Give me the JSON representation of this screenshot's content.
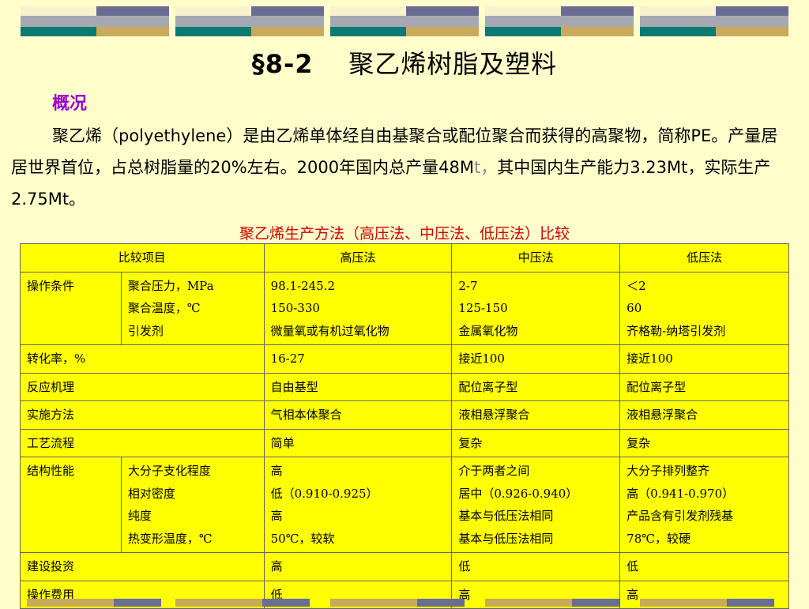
{
  "title_section": "§",
  "title_number": "8-2",
  "title_text": "聚乙烯树脂及塑料",
  "subhead": "概况",
  "paragraph": {
    "part1": "聚乙烯（polyethylene）是由乙烯单体经自由基聚合或配位聚合而获得的高聚物，简称PE。产量居居世界首位，占总树脂量的20%左右。2000年国内总产量48M",
    "dim": "t，",
    "part2": "其中国内生产能力3.23Mt，实际生产2.75Mt。"
  },
  "caption": "聚乙烯生产方法（高压法、中压法、低压法）比较",
  "table": {
    "header": {
      "item": "比较项目",
      "high": "高压法",
      "mid": "中压法",
      "low": "低压法"
    },
    "r1": {
      "label": "操作条件",
      "sub": [
        "聚合压力，MPa",
        "聚合温度，℃",
        "引发剂"
      ],
      "high": [
        "98.1-245.2",
        "150-330",
        "微量氧或有机过氧化物"
      ],
      "mid": [
        "2-7",
        "125-150",
        "金属氧化物"
      ],
      "low": [
        "＜2",
        "60",
        "齐格勒-纳塔引发剂"
      ]
    },
    "r2": {
      "label": "转化率，%",
      "high": "16-27",
      "mid": "接近100",
      "low": "接近100"
    },
    "r3": {
      "label": "反应机理",
      "high": "自由基型",
      "mid": "配位离子型",
      "low": "配位离子型"
    },
    "r4": {
      "label": "实施方法",
      "high": "气相本体聚合",
      "mid": "液相悬浮聚合",
      "low": "液相悬浮聚合"
    },
    "r5": {
      "label": "工艺流程",
      "high": "简单",
      "mid": "复杂",
      "low": "复杂"
    },
    "r6": {
      "label": "结构性能",
      "sub": [
        "大分子支化程度",
        "相对密度",
        "纯度",
        "热变形温度，℃"
      ],
      "high": [
        "高",
        "低（0.910-0.925）",
        "高",
        "50℃，较软"
      ],
      "mid": [
        "介于两者之间",
        "居中（0.926-0.940）",
        "基本与低压法相同",
        "基本与低压法相同"
      ],
      "low": [
        "大分子排列整齐",
        "高（0.941-0.970）",
        "产品含有引发剂残基",
        "78℃，较硬"
      ]
    },
    "r7": {
      "label": "建设投资",
      "high": "高",
      "mid": "低",
      "low": "低"
    },
    "r8": {
      "label": "操作费用",
      "high": "低",
      "mid": "高",
      "low": "高"
    }
  }
}
